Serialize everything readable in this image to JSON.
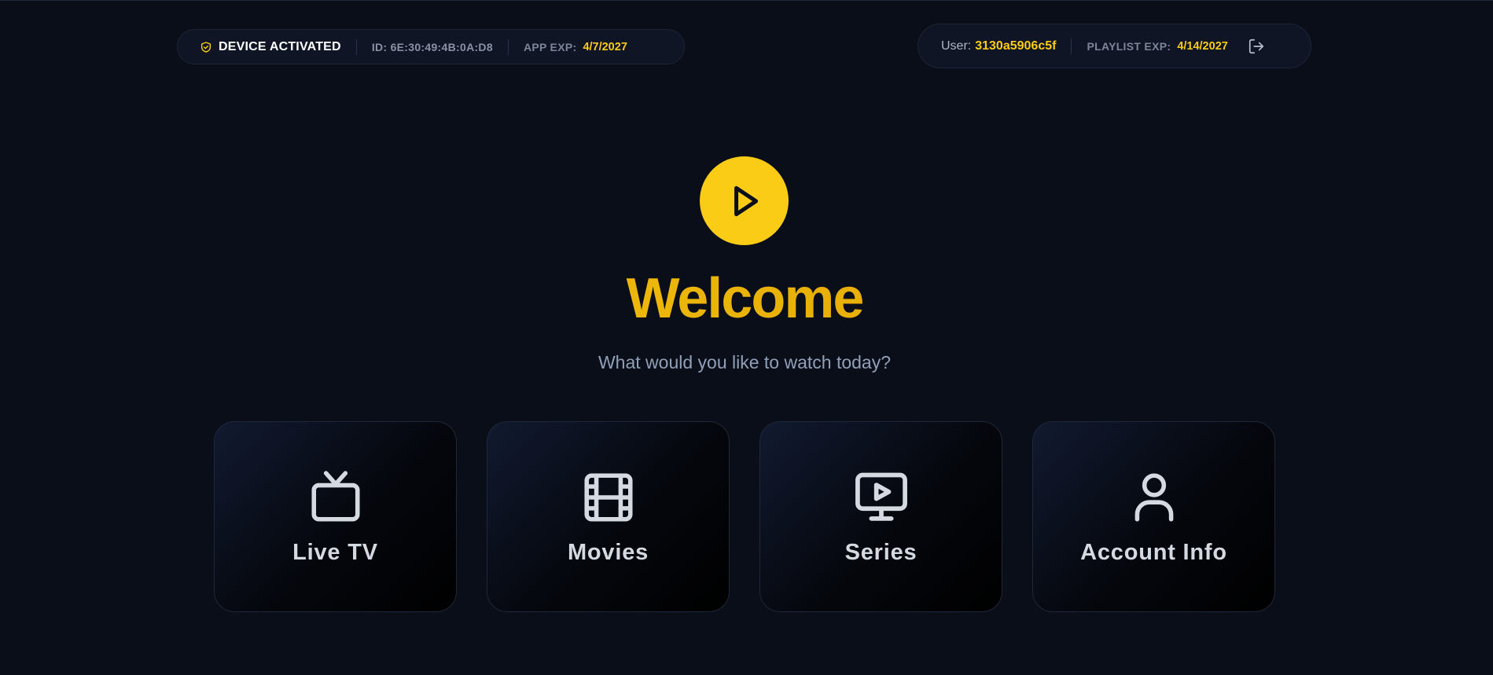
{
  "status_bar": {
    "device_status": "DEVICE ACTIVATED",
    "device_id": "ID: 6E:30:49:4B:0A:D8",
    "app_exp_label": "APP EXP:",
    "app_exp_value": "4/7/2027"
  },
  "account_bar": {
    "user_label": "User:",
    "user_value": "3130a5906c5f",
    "playlist_exp_label": "PLAYLIST EXP:",
    "playlist_exp_value": "4/14/2027",
    "logout_icon": "logout-icon"
  },
  "hero": {
    "icon": "play-icon",
    "title": "Welcome",
    "subtitle": "What would you like to watch today?"
  },
  "menu": {
    "items": [
      {
        "label": "Live TV",
        "icon": "tv-icon"
      },
      {
        "label": "Movies",
        "icon": "film-icon"
      },
      {
        "label": "Series",
        "icon": "monitor-play-icon"
      },
      {
        "label": "Account Info",
        "icon": "user-icon"
      }
    ]
  },
  "colors": {
    "accent": "#facc15",
    "background": "#0a0e18",
    "subtitle": "#8fa0b8"
  }
}
